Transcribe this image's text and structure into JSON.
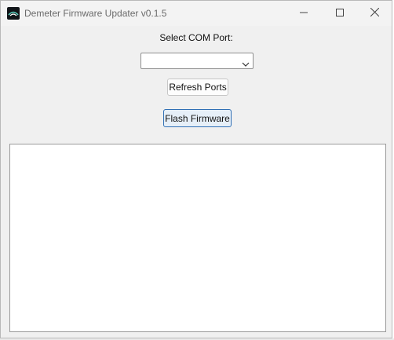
{
  "window": {
    "title": "Demeter Firmware Updater v0.1.5",
    "icon": "demeter-logo-icon",
    "controls": [
      "minimize-icon",
      "maximize-icon",
      "close-icon"
    ]
  },
  "com_port": {
    "label": "Select COM Port:",
    "selected_value": ""
  },
  "buttons": {
    "refresh_label": "Refresh Ports",
    "flash_label": "Flash Firmware"
  },
  "log": {
    "content": ""
  },
  "colors": {
    "window_bg": "#f0f0f0",
    "focus_accent": "#2f6fb5"
  }
}
